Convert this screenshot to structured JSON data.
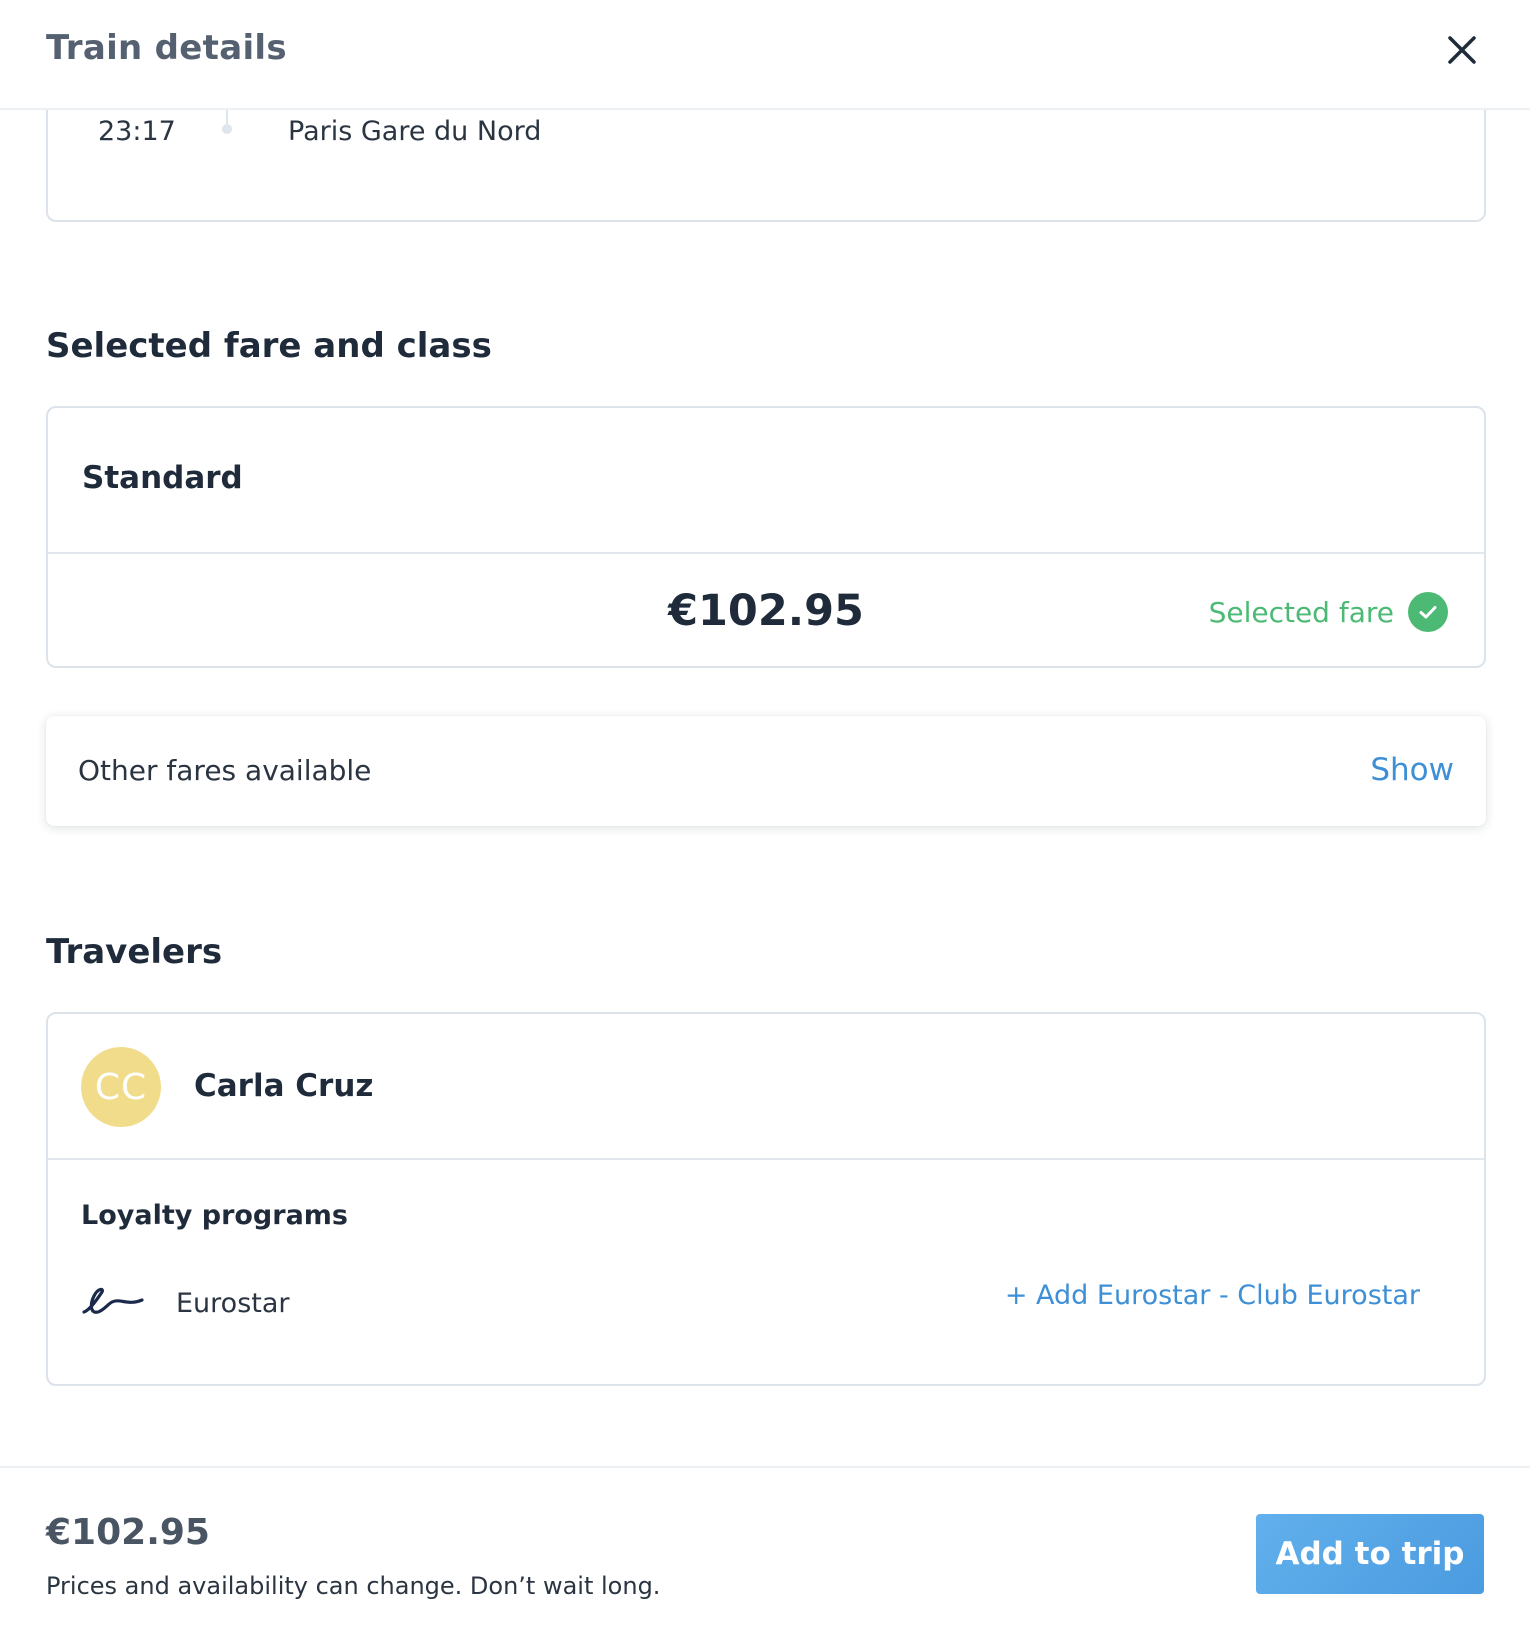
{
  "header": {
    "title": "Train details",
    "close_icon": "close-icon"
  },
  "route": {
    "time": "23:17",
    "station": "Paris Gare du Nord"
  },
  "fare_section": {
    "title": "Selected fare and class",
    "class_name": "Standard",
    "price": "€102.95",
    "selected_label": "Selected fare",
    "selected_icon": "check-circle-icon",
    "accent_color": "#4cba74"
  },
  "other_fares": {
    "label": "Other fares available",
    "show_label": "Show"
  },
  "travelers_section": {
    "title": "Travelers",
    "traveler": {
      "initials": "CC",
      "name": "Carla Cruz",
      "avatar_color": "#f1dc8c"
    },
    "loyalty": {
      "title": "Loyalty programs",
      "program_icon": "eurostar-logo-icon",
      "program_name": "Eurostar",
      "add_label": "+ Add Eurostar - Club Eurostar"
    }
  },
  "footer": {
    "total_price": "€102.95",
    "note": "Prices and availability can change. Don’t wait long.",
    "add_button_label": "Add to trip",
    "link_color": "#3d8fd6"
  }
}
